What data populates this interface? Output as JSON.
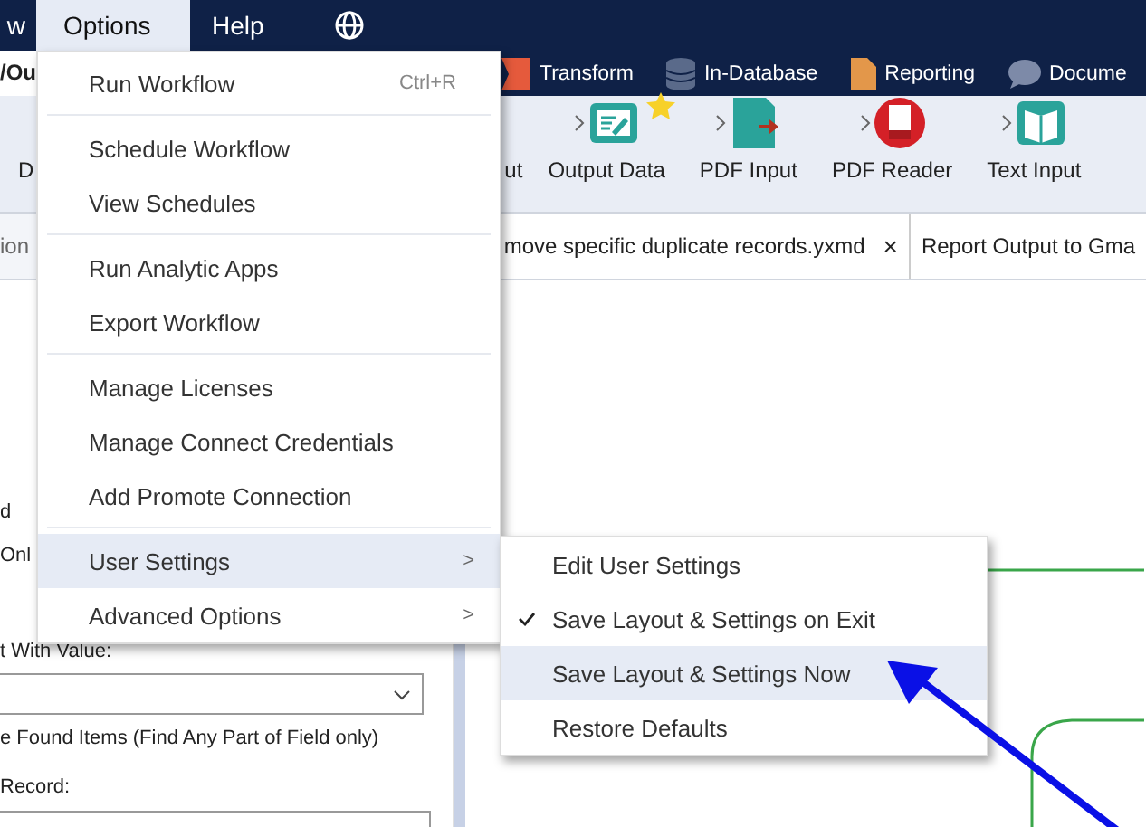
{
  "menu_bar": [
    {
      "label": "w",
      "selected": false
    },
    {
      "label": "Options",
      "selected": true
    },
    {
      "label": "Help",
      "selected": false
    }
  ],
  "breadcrumb": "/Ou",
  "categories": [
    {
      "label": "Transform",
      "kind": "transform"
    },
    {
      "label": "In-Database",
      "kind": "database"
    },
    {
      "label": "Reporting",
      "kind": "reporting"
    },
    {
      "label": "Docume",
      "kind": "documentation"
    }
  ],
  "tools": [
    {
      "label": "D",
      "kind": "none"
    },
    {
      "label": "ut",
      "kind": "none"
    },
    {
      "label": "Output Data",
      "kind": "output",
      "favorite": true
    },
    {
      "label": "PDF Input",
      "kind": "pdf-input",
      "favorite": false
    },
    {
      "label": "PDF Reader",
      "kind": "pdf-reader",
      "favorite": false
    },
    {
      "label": "Text Input",
      "kind": "text-input",
      "favorite": false
    }
  ],
  "panel_tab": "ion",
  "doc_tabs": [
    {
      "label": "move specific duplicate records.yxmd",
      "close": "×"
    },
    {
      "label": "Report Output to Gma"
    }
  ],
  "config": {
    "line_1": "d",
    "line_2": "Onl",
    "value_label": "t With Value:",
    "found_items": "e Found Items (Find Any Part of Field only)",
    "record_label": "Record:"
  },
  "options_menu": [
    {
      "label": "Run Workflow",
      "shortcut": "Ctrl+R",
      "group_end": true
    },
    {
      "label": "Schedule Workflow",
      "group_end": false
    },
    {
      "label": "View Schedules",
      "group_end": true
    },
    {
      "label": "Run Analytic Apps",
      "group_end": false
    },
    {
      "label": "Export Workflow",
      "group_end": true
    },
    {
      "label": "Manage Licenses",
      "group_end": false
    },
    {
      "label": "Manage Connect Credentials",
      "group_end": false
    },
    {
      "label": "Add Promote Connection",
      "group_end": true
    },
    {
      "label": "User Settings",
      "submenu": ">",
      "selected": true,
      "group_end": false
    },
    {
      "label": "Advanced Options",
      "submenu": ">",
      "selected": false,
      "group_end": false
    }
  ],
  "user_settings_menu": [
    {
      "label": "Edit User Settings",
      "checked": false,
      "selected": false
    },
    {
      "label": "Save Layout & Settings on Exit",
      "checked": true,
      "selected": false
    },
    {
      "label": "Save Layout & Settings Now",
      "checked": false,
      "selected": true
    },
    {
      "label": "Restore Defaults",
      "checked": false,
      "selected": false
    }
  ]
}
